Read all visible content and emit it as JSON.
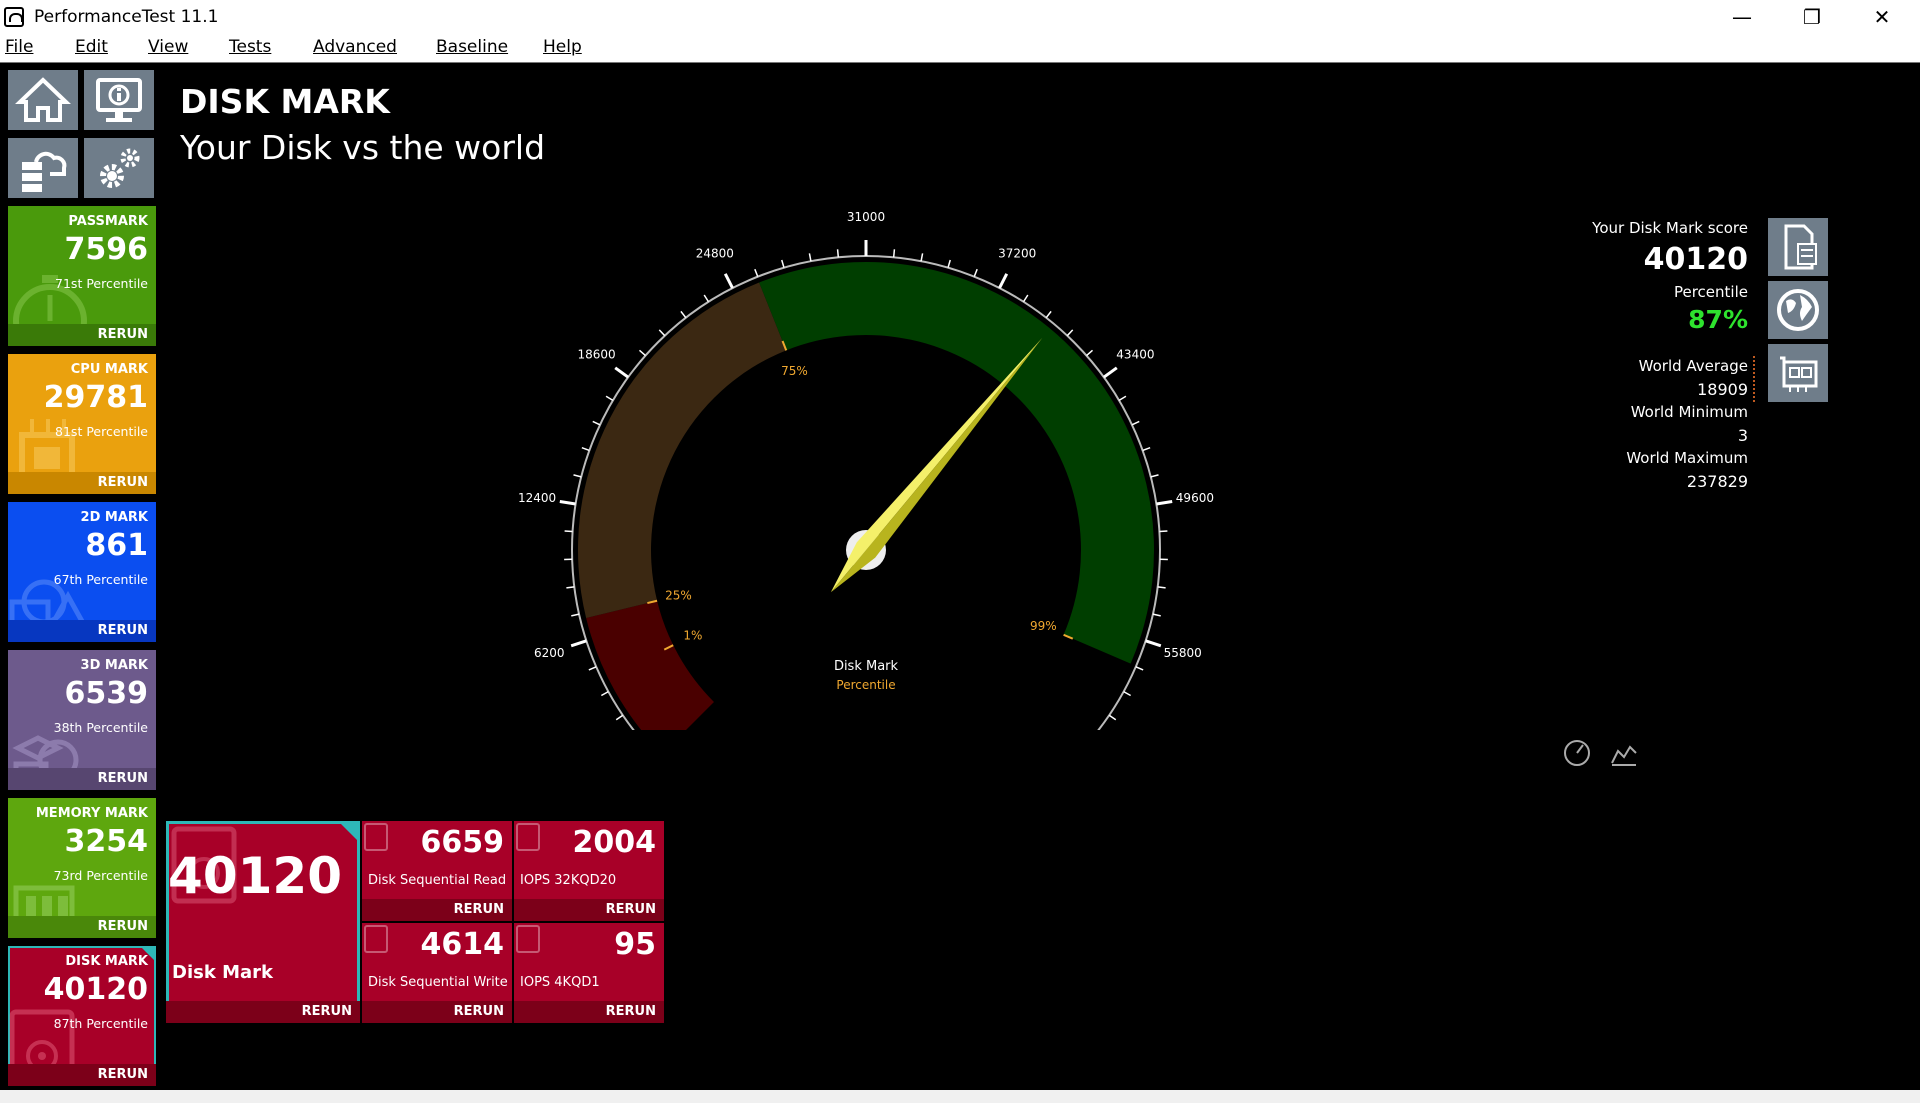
{
  "window": {
    "title": "PerformanceTest 11.1"
  },
  "menu": [
    "File",
    "Edit",
    "View",
    "Tests",
    "Advanced",
    "Baseline",
    "Help"
  ],
  "nav_icons": [
    "home-icon",
    "system-info-icon",
    "cloud-database-icon",
    "gear-icon"
  ],
  "tiles": [
    {
      "name": "PASSMARK",
      "value": "7596",
      "percentile": "71st Percentile",
      "rerun": "RERUN",
      "bg": "#4a9a0c",
      "footer": "#3a7a08"
    },
    {
      "name": "CPU MARK",
      "value": "29781",
      "percentile": "81st Percentile",
      "rerun": "RERUN",
      "bg": "#eaa10e",
      "footer": "#c98700"
    },
    {
      "name": "2D MARK",
      "value": "861",
      "percentile": "67th Percentile",
      "rerun": "RERUN",
      "bg": "#0b4ef0",
      "footer": "#0737c0"
    },
    {
      "name": "3D MARK",
      "value": "6539",
      "percentile": "38th Percentile",
      "rerun": "RERUN",
      "bg": "#6d5a8c",
      "footer": "#574670"
    },
    {
      "name": "MEMORY MARK",
      "value": "3254",
      "percentile": "73rd Percentile",
      "rerun": "RERUN",
      "bg": "#5ea70e",
      "footer": "#4a880a"
    },
    {
      "name": "DISK MARK",
      "value": "40120",
      "percentile": "87th Percentile",
      "rerun": "RERUN",
      "bg": "#a80028",
      "footer": "#7c0019"
    }
  ],
  "heading": "DISK MARK",
  "subheading": "Your Disk vs the world",
  "gauge": {
    "ticks": [
      "0",
      "6200",
      "12400",
      "18600",
      "24800",
      "31000",
      "37200",
      "43400",
      "49600",
      "55800",
      "62000"
    ],
    "min": 0,
    "max": 62000,
    "value": 40120,
    "percentile_marks": [
      {
        "label": "1%",
        "value": 4300
      },
      {
        "label": "25%",
        "value": 7200
      },
      {
        "label": "75%",
        "value": 26000
      },
      {
        "label": "99%",
        "value": 57000
      }
    ],
    "center_label": "Disk Mark",
    "center_sublabel": "Percentile",
    "colors": {
      "band1": "#4a0000",
      "band2": "#3b2812",
      "band3": "#003e00",
      "needle": "#e6e23a"
    }
  },
  "info": {
    "score_label": "Your Disk Mark score",
    "score": "40120",
    "percentile_label": "Percentile",
    "percentile": "87%",
    "world_avg_label": "World Average",
    "world_avg": "18909",
    "world_min_label": "World Minimum",
    "world_min": "3",
    "world_max_label": "World Maximum",
    "world_max": "237829"
  },
  "main_tile": {
    "value": "40120",
    "label": "Disk Mark",
    "rerun": "RERUN"
  },
  "subtests": [
    {
      "value": "6659",
      "label": "Disk Sequential Read",
      "rerun": "RERUN"
    },
    {
      "value": "2004",
      "label": "IOPS 32KQD20",
      "rerun": "RERUN"
    },
    {
      "value": "4614",
      "label": "Disk Sequential Write",
      "rerun": "RERUN"
    },
    {
      "value": "95",
      "label": "IOPS 4KQD1",
      "rerun": "RERUN"
    }
  ]
}
